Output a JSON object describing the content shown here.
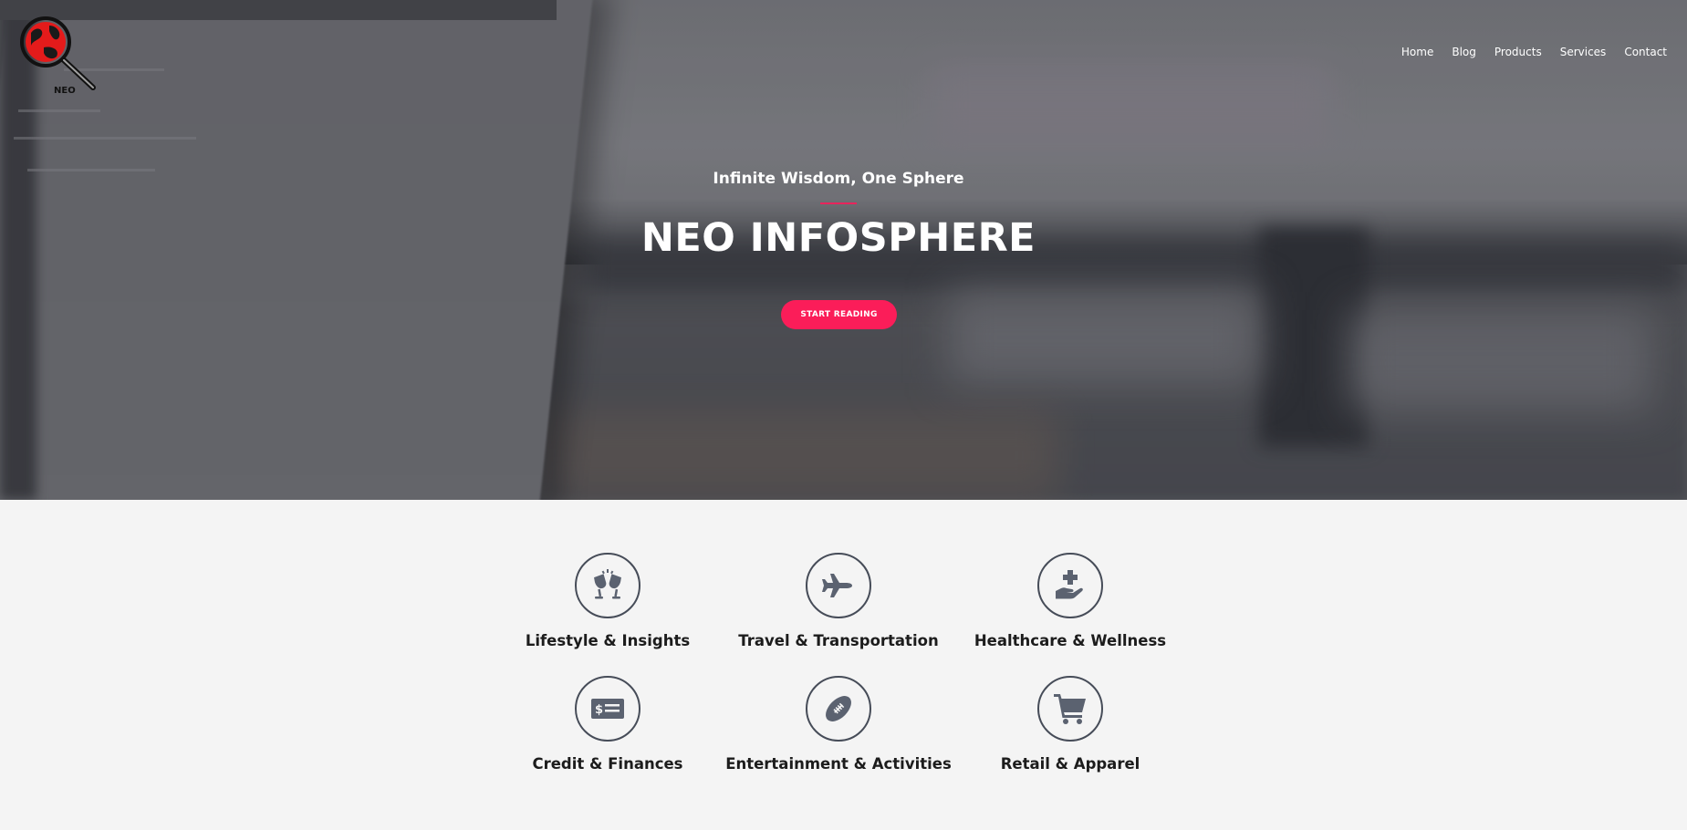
{
  "brand": {
    "logo_text": "NEO",
    "accent_color": "#fb1d59",
    "logo_colors": {
      "globe": "#e41b1b",
      "ring": "#111111"
    }
  },
  "nav": {
    "items": [
      {
        "label": "Home"
      },
      {
        "label": "Blog"
      },
      {
        "label": "Products"
      },
      {
        "label": "Services"
      },
      {
        "label": "Contact"
      }
    ]
  },
  "hero": {
    "tagline": "Infinite Wisdom, One Sphere",
    "title": "NEO INFOSPHERE",
    "cta_label": "START READING"
  },
  "categories": {
    "icon_color": "#5b6270",
    "items": [
      {
        "label": "Lifestyle & Insights",
        "icon": "glasses-cheers-icon"
      },
      {
        "label": "Travel & Transportation",
        "icon": "plane-icon"
      },
      {
        "label": "Healthcare & Wellness",
        "icon": "hand-holding-medical-icon"
      },
      {
        "label": "Credit & Finances",
        "icon": "money-check-icon"
      },
      {
        "label": "Entertainment & Activities",
        "icon": "football-icon"
      },
      {
        "label": "Retail & Apparel",
        "icon": "shopping-cart-icon"
      }
    ]
  }
}
